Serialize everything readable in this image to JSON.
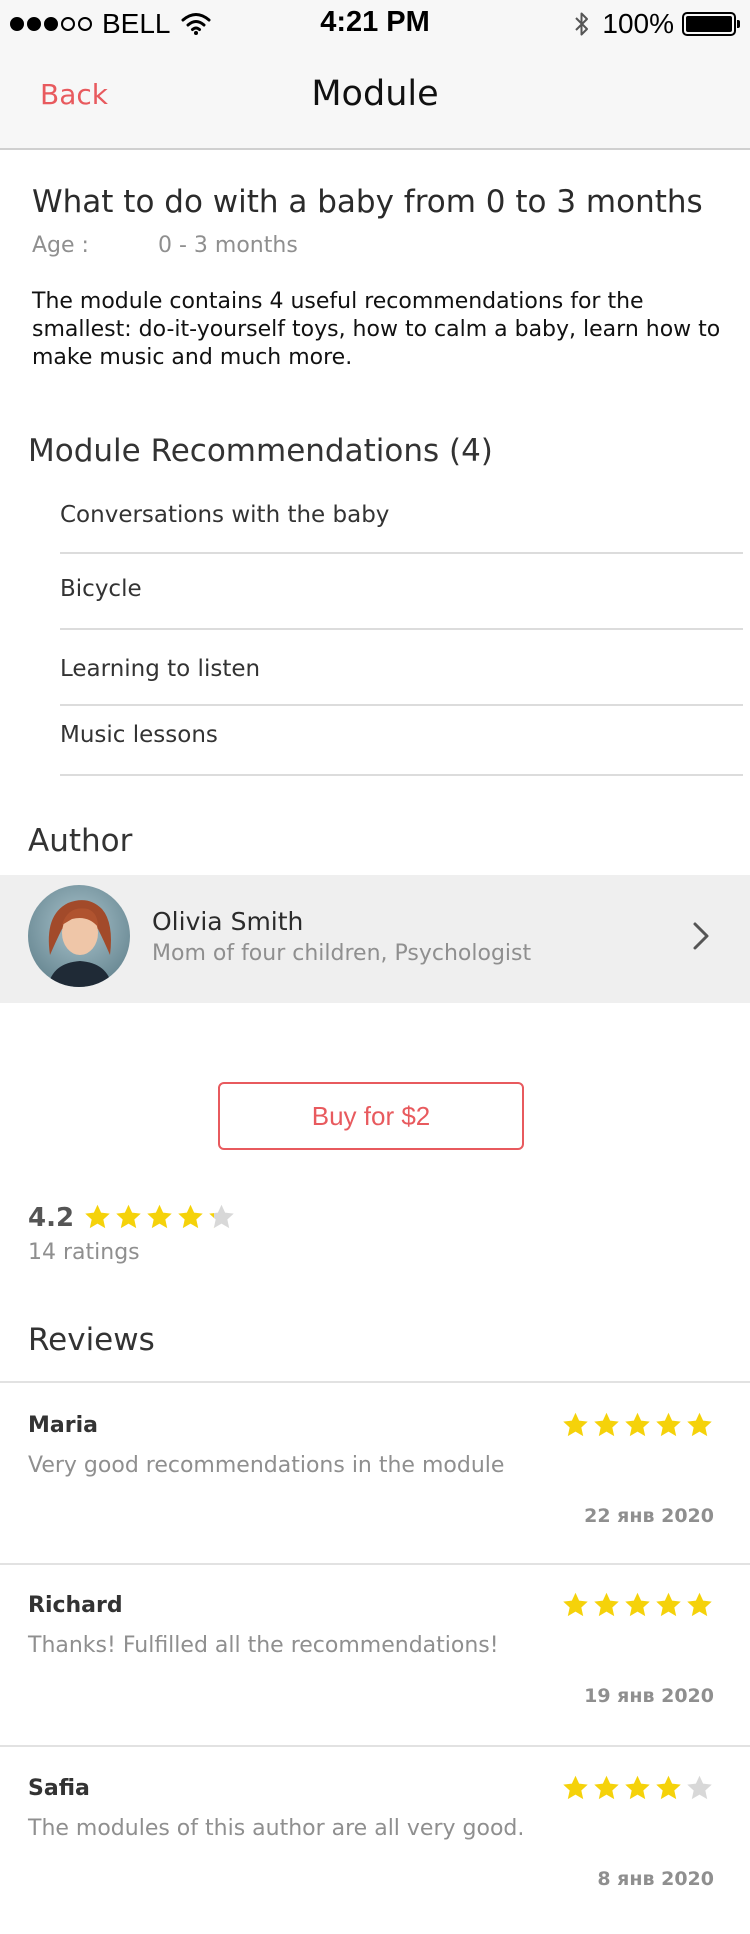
{
  "status_bar": {
    "carrier": "BELL",
    "time": "4:21 PM",
    "battery": "100%",
    "signal_strength": 3,
    "signal_max": 5
  },
  "nav": {
    "back_label": "Back",
    "title": "Module"
  },
  "module": {
    "title": "What to do with a baby from 0 to 3 months",
    "age_label": "Age :",
    "age_value": "0 - 3 months",
    "description": "The module contains 4 useful recommendations for the smallest: do-it-yourself toys, how to calm a baby, learn how to make music and much more."
  },
  "recommendations": {
    "heading": "Module Recommendations (4)",
    "items": [
      {
        "label": "Conversations with the baby"
      },
      {
        "label": "Bicycle"
      },
      {
        "label": "Learning to listen"
      },
      {
        "label": "Music lessons"
      }
    ]
  },
  "author": {
    "heading": "Author",
    "name": "Olivia Smith",
    "role": "Mom of four children, Psychologist"
  },
  "buy": {
    "label": "Buy for $2"
  },
  "rating": {
    "value": "4.2",
    "stars": 4.2,
    "max": 5,
    "count_label": "14 ratings"
  },
  "reviews": {
    "heading": "Reviews",
    "items": [
      {
        "name": "Maria",
        "stars": 5,
        "text": "Very good recommendations in the module",
        "date": "22 янв 2020"
      },
      {
        "name": "Richard",
        "stars": 5,
        "text": "Thanks! Fulfilled all the recommendations!",
        "date": "19 янв 2020"
      },
      {
        "name": "Safia",
        "stars": 4,
        "text": "The modules of this author are all very good.",
        "date": "8 янв 2020"
      }
    ]
  },
  "colors": {
    "accent": "#e85a5e",
    "star": "#f5d20a",
    "star_empty": "#d8d8d8"
  },
  "icons": [
    "signal-dots-icon",
    "wifi-icon",
    "bluetooth-icon",
    "battery-icon",
    "chevron-right-icon",
    "star-icon"
  ]
}
